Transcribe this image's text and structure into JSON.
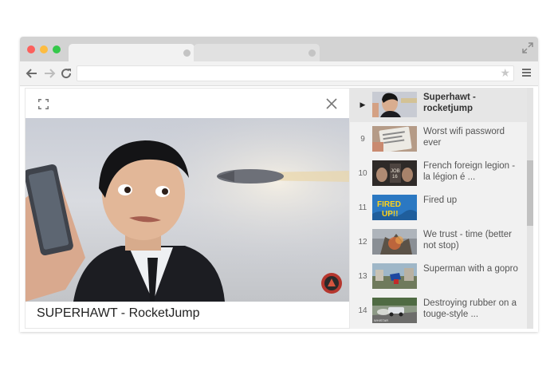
{
  "browser": {
    "window_controls": [
      "close",
      "minimize",
      "maximize"
    ],
    "tabs": [
      {
        "state": "active"
      },
      {
        "state": "inactive"
      }
    ],
    "address_bar": {
      "value": ""
    }
  },
  "player": {
    "title": "SUPERHAWT - RocketJump"
  },
  "playlist": {
    "items": [
      {
        "marker": "▶",
        "title": "Superhawt - rocketjump",
        "active": true
      },
      {
        "marker": "9",
        "title": "Worst wifi password ever"
      },
      {
        "marker": "10",
        "title": "French foreign legion - la légion é ..."
      },
      {
        "marker": "11",
        "title": "Fired up"
      },
      {
        "marker": "12",
        "title": "We trust - time (better not stop)"
      },
      {
        "marker": "13",
        "title": "Superman with a gopro"
      },
      {
        "marker": "14",
        "title": "Destroying rubber on a touge-style  ..."
      }
    ]
  },
  "colors": {
    "titlebar": "#d3d3d3",
    "close": "#fc605c",
    "minimize": "#fdbc40",
    "maximize": "#34c84a",
    "playlist_bg": "#f1f1f1"
  }
}
